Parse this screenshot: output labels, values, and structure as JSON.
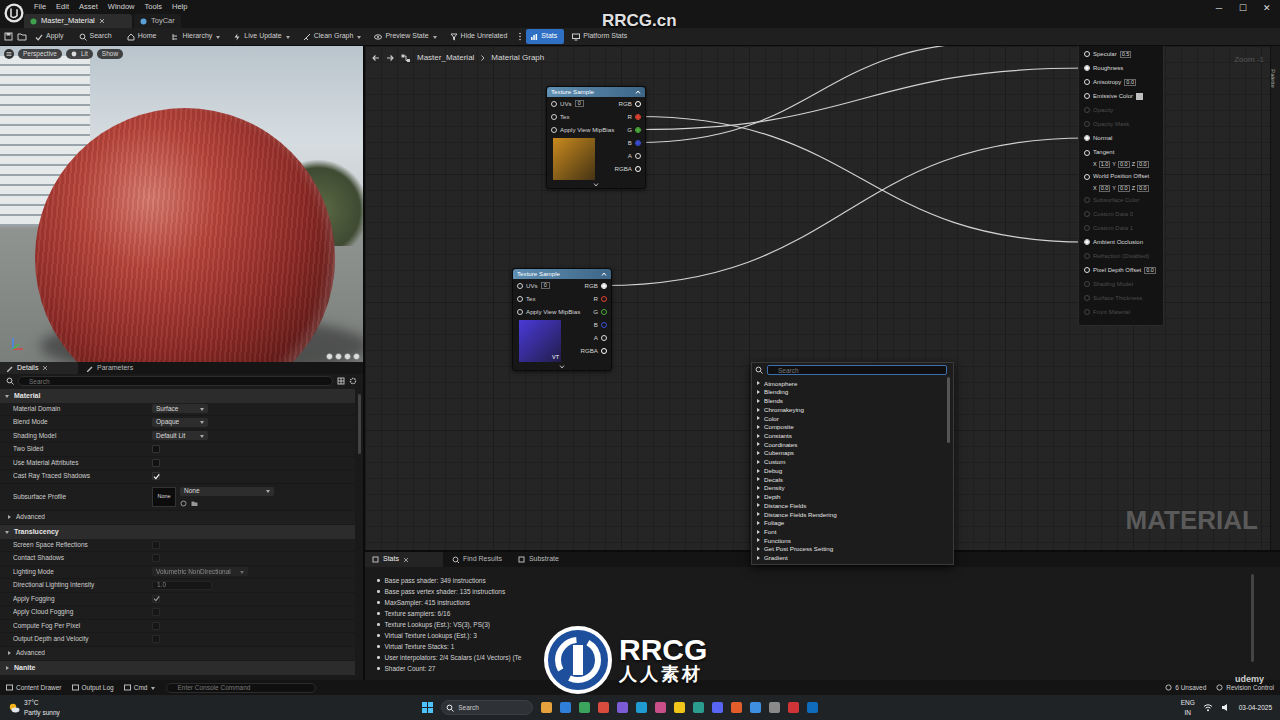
{
  "window": {
    "tabs": [
      {
        "label": "Master_Material",
        "selected": true
      },
      {
        "label": "ToyCar",
        "selected": false
      }
    ],
    "controls": [
      "─",
      "☐",
      "✕"
    ]
  },
  "menu": [
    "File",
    "Edit",
    "Asset",
    "Window",
    "Tools",
    "Help"
  ],
  "toolbar": [
    {
      "label": "Apply",
      "dropdown": false,
      "selected": false
    },
    {
      "label": "Search",
      "dropdown": false,
      "selected": false
    },
    {
      "label": "Home",
      "dropdown": false,
      "selected": false
    },
    {
      "label": "Hierarchy",
      "dropdown": true,
      "selected": false
    },
    {
      "label": "Live Update",
      "dropdown": true,
      "selected": false
    },
    {
      "label": "Clean Graph",
      "dropdown": true,
      "selected": false
    },
    {
      "label": "Preview State",
      "dropdown": true,
      "selected": false
    },
    {
      "label": "Hide Unrelated",
      "dropdown": false,
      "selected": false
    },
    {
      "label": "Stats",
      "dropdown": false,
      "selected": true
    },
    {
      "label": "Platform Stats",
      "dropdown": false,
      "selected": false
    }
  ],
  "viewport": {
    "buttons": [
      "Perspective",
      "Lit",
      "Show"
    ]
  },
  "details": {
    "tabs": [
      {
        "label": "Details",
        "selected": true
      },
      {
        "label": "Parameters",
        "selected": false
      }
    ],
    "search": {
      "placeholder": "Search"
    },
    "items": [
      {
        "kind": "section",
        "label": "Material",
        "expanded": true
      },
      {
        "kind": "dropdown",
        "label": "Material Domain",
        "value": "Surface",
        "disabled": false
      },
      {
        "kind": "dropdown",
        "label": "Blend Mode",
        "value": "Opaque",
        "disabled": false
      },
      {
        "kind": "dropdown",
        "label": "Shading Model",
        "value": "Default Lit",
        "disabled": false
      },
      {
        "kind": "checkbox",
        "label": "Two Sided",
        "checked": false,
        "disabled": false
      },
      {
        "kind": "checkbox",
        "label": "Use Material Attributes",
        "checked": false,
        "disabled": false
      },
      {
        "kind": "checkbox",
        "label": "Cast Ray Traced Shadows",
        "checked": true,
        "disabled": false
      },
      {
        "kind": "asset",
        "label": "Subsurface Profile",
        "thumb": "None",
        "value": "None"
      },
      {
        "kind": "group",
        "label": "Advanced",
        "expanded": false
      },
      {
        "kind": "section",
        "label": "Translucency",
        "expanded": true
      },
      {
        "kind": "checkbox",
        "label": "Screen Space Reflections",
        "checked": false,
        "disabled": true
      },
      {
        "kind": "checkbox",
        "label": "Contact Shadows",
        "checked": false,
        "disabled": true
      },
      {
        "kind": "dropdown",
        "label": "Lighting Mode",
        "value": "Volumetric NonDirectional",
        "disabled": true
      },
      {
        "kind": "number",
        "label": "Directional Lighting Intensity",
        "value": "1.0",
        "disabled": true
      },
      {
        "kind": "checkbox",
        "label": "Apply Fogging",
        "checked": true,
        "disabled": true
      },
      {
        "kind": "checkbox",
        "label": "Apply Cloud Fogging",
        "checked": false,
        "disabled": true
      },
      {
        "kind": "checkbox",
        "label": "Compute Fog Per Pixel",
        "checked": false,
        "disabled": true
      },
      {
        "kind": "checkbox",
        "label": "Output Depth and Velocity",
        "checked": false,
        "disabled": true
      },
      {
        "kind": "group",
        "label": "Advanced",
        "expanded": false
      },
      {
        "kind": "section",
        "label": "Nanite",
        "expanded": false
      }
    ]
  },
  "graph": {
    "breadcrumb": [
      "Master_Material",
      "Material Graph"
    ],
    "zoom": "Zoom -1",
    "label": "MATERIAL",
    "palette": "Palette",
    "texture_samples": [
      {
        "title": "Texture Sample",
        "color": "#c98a1e",
        "badge": "",
        "inputs": [
          {
            "label": "UVs",
            "value": "0"
          },
          {
            "label": "Tex",
            "value": ""
          },
          {
            "label": "Apply View MipBias",
            "value": ""
          }
        ],
        "outputs": [
          {
            "label": "RGB",
            "color": "#ffffff",
            "connected": false
          },
          {
            "label": "R",
            "color": "#e0422f",
            "connected": true
          },
          {
            "label": "G",
            "color": "#4caf3a",
            "connected": true
          },
          {
            "label": "B",
            "color": "#3a4fd8",
            "connected": true
          },
          {
            "label": "A",
            "color": "#dddddd",
            "connected": false
          },
          {
            "label": "RGBA",
            "color": "#ffffff",
            "connected": false
          }
        ]
      },
      {
        "title": "Texture Sample",
        "color": "#4a3ad8",
        "badge": "VT",
        "inputs": [
          {
            "label": "UVs",
            "value": "0"
          },
          {
            "label": "Tex",
            "value": ""
          },
          {
            "label": "Apply View MipBias",
            "value": ""
          }
        ],
        "outputs": [
          {
            "label": "RGB",
            "color": "#ffffff",
            "connected": true
          },
          {
            "label": "R",
            "color": "#e0422f",
            "connected": false
          },
          {
            "label": "G",
            "color": "#4caf3a",
            "connected": false
          },
          {
            "label": "B",
            "color": "#3a4fd8",
            "connected": false
          },
          {
            "label": "A",
            "color": "#dddddd",
            "connected": false
          },
          {
            "label": "RGBA",
            "color": "#ffffff",
            "connected": false
          }
        ]
      }
    ],
    "result_pins": [
      {
        "label": "Specular",
        "kind": "scalar",
        "value": "0.5",
        "enabled": true,
        "connected": false
      },
      {
        "label": "Roughness",
        "kind": "plain",
        "enabled": true,
        "connected": true
      },
      {
        "label": "Anisotropy",
        "kind": "scalar",
        "value": "0.0",
        "enabled": true,
        "connected": false
      },
      {
        "label": "Emissive Color",
        "kind": "color",
        "enabled": true,
        "connected": false
      },
      {
        "label": "Opacity",
        "kind": "plain",
        "enabled": false,
        "connected": false
      },
      {
        "label": "Opacity Mask",
        "kind": "plain",
        "enabled": false,
        "connected": false
      },
      {
        "label": "Normal",
        "kind": "plain",
        "enabled": true,
        "connected": true
      },
      {
        "label": "Tangent",
        "kind": "vector",
        "axes": [
          "X",
          "Y",
          "Z"
        ],
        "values": [
          "1.0",
          "0.0",
          "0.0"
        ],
        "enabled": true,
        "connected": false
      },
      {
        "label": "World Position Offset",
        "kind": "vector",
        "axes": [
          "X",
          "Y",
          "Z"
        ],
        "values": [
          "0.0",
          "0.0",
          "0.0"
        ],
        "enabled": true,
        "connected": false
      },
      {
        "label": "Subsurface Color",
        "kind": "plain",
        "enabled": false,
        "connected": false
      },
      {
        "label": "Custom Data 0",
        "kind": "plain",
        "enabled": false,
        "connected": false
      },
      {
        "label": "Custom Data 1",
        "kind": "plain",
        "enabled": false,
        "connected": false
      },
      {
        "label": "Ambient Occlusion",
        "kind": "plain",
        "enabled": true,
        "connected": true
      },
      {
        "label": "Refraction (Disabled)",
        "kind": "plain",
        "enabled": false,
        "connected": false
      },
      {
        "label": "Pixel Depth Offset",
        "kind": "scalar",
        "value": "0.0",
        "enabled": true,
        "connected": false
      },
      {
        "label": "Shading Model",
        "kind": "plain",
        "enabled": false,
        "connected": false
      },
      {
        "label": "Surface Thickness",
        "kind": "plain",
        "enabled": false,
        "connected": false
      },
      {
        "label": "Front Material",
        "kind": "plain",
        "enabled": false,
        "connected": false
      }
    ],
    "links": [
      {
        "node": 0,
        "pin": "R",
        "to": 12
      },
      {
        "node": 0,
        "pin": "G",
        "to": 1
      },
      {
        "node": 0,
        "pin": "B",
        "to": -1
      },
      {
        "node": 1,
        "pin": "RGB",
        "to": 6
      }
    ]
  },
  "context_menu": {
    "search": {
      "placeholder": "Search"
    },
    "items": [
      {
        "label": "Atmosphere",
        "expanded": false
      },
      {
        "label": "Blending",
        "expanded": false
      },
      {
        "label": "Blends",
        "expanded": false
      },
      {
        "label": "Chromakeying",
        "expanded": false
      },
      {
        "label": "Color",
        "expanded": false
      },
      {
        "label": "Composite",
        "expanded": false
      },
      {
        "label": "Constants",
        "expanded": false
      },
      {
        "label": "Coordinates",
        "expanded": false
      },
      {
        "label": "Cubemaps",
        "expanded": false
      },
      {
        "label": "Custom",
        "expanded": false
      },
      {
        "label": "Debug",
        "expanded": false
      },
      {
        "label": "Decals",
        "expanded": false
      },
      {
        "label": "Density",
        "expanded": false
      },
      {
        "label": "Depth",
        "expanded": false
      },
      {
        "label": "Distance Fields",
        "expanded": false
      },
      {
        "label": "Distance Fields Rendering",
        "expanded": false
      },
      {
        "label": "Foliage",
        "expanded": false
      },
      {
        "label": "Font",
        "expanded": false
      },
      {
        "label": "Functions",
        "expanded": false
      },
      {
        "label": "Get Post Process Setting",
        "expanded": false
      },
      {
        "label": "Gradient",
        "expanded": false
      }
    ]
  },
  "stats": {
    "tabs": [
      {
        "label": "Stats",
        "selected": true
      },
      {
        "label": "Find Results",
        "selected": false
      },
      {
        "label": "Substrate",
        "selected": false
      }
    ],
    "lines": [
      "Base pass shader: 349 instructions",
      "Base pass vertex shader: 135 instructions",
      "MaxSampler: 415 instructions",
      "Texture samplers: 6/16",
      "Texture Lookups (Est.): VS(3), PS(3)",
      "Virtual Texture Lookups (Est.): 3",
      "Virtual Texture Stacks: 1",
      "User interpolators: 2/4 Scalars (1/4 Vectors) (Te",
      "Shader Count: 27"
    ]
  },
  "status_bar": {
    "left": [
      "Content Drawer",
      "Output Log",
      "Cmd"
    ],
    "console_placeholder": "Enter Console Command",
    "right": [
      "6 Unsaved",
      "Revision Control"
    ]
  },
  "taskbar": {
    "temperature": "37°C",
    "weather": "Partly sunny",
    "search_placeholder": "Search",
    "language": [
      "ENG",
      "IN"
    ],
    "date": "03-04-2025"
  },
  "watermarks": {
    "site": "RRCG.cn",
    "logo": "RRCG",
    "logo_sub": "人人素材",
    "course": "udemy"
  }
}
